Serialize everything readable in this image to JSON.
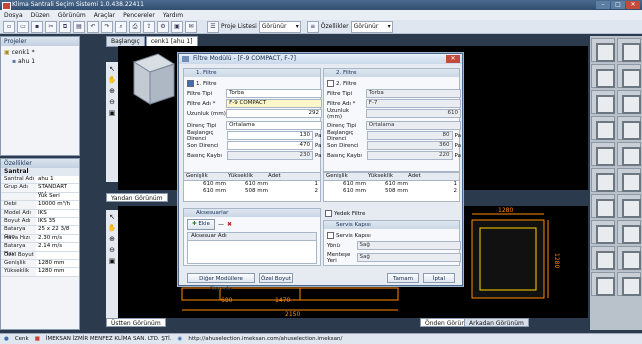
{
  "window": {
    "title": "Klima Santrali Seçim Sistemi 1.0.438.22411"
  },
  "menu": [
    "Dosya",
    "Düzen",
    "Görünüm",
    "Araçlar",
    "Pencereler",
    "Yardım"
  ],
  "toolbar": {
    "project_list_label": "Proje Listesi",
    "view_combo_1": "Görünür",
    "properties_label": "Özellikler",
    "view_combo_2": "Görünür"
  },
  "projects_panel": {
    "title": "Projeler",
    "tree": [
      {
        "label": "cenk1 *"
      },
      {
        "label": "ahu 1"
      }
    ]
  },
  "properties_panel": {
    "title": "Özellikler",
    "section": "Santral",
    "rows": [
      {
        "k": "Santral Adı",
        "v": "ahu 1"
      },
      {
        "k": "Grup Adı",
        "v": "STANDART KLİ..."
      },
      {
        "k": "",
        "v": "Yük Seri"
      },
      {
        "k": "Debi",
        "v": "10000 m³/h"
      },
      {
        "k": "Model Adı",
        "v": "IKS"
      },
      {
        "k": "Boyut Adı",
        "v": "IKS 35"
      },
      {
        "k": "Batarya Geo",
        "v": "25 x 22 3/8"
      },
      {
        "k": "Hava Hızı",
        "v": "2.30 m/s"
      },
      {
        "k": "Batarya Hav",
        "v": "2.14 m/s"
      },
      {
        "k": "Özel Boyut",
        "v": ""
      },
      {
        "k": "Genişlik",
        "v": "1280 mm"
      },
      {
        "k": "Yükseklik",
        "v": "1280 mm"
      }
    ]
  },
  "doc_tabs": [
    "Başlangıç",
    "cenk1 [ahu 1]"
  ],
  "view_labels": {
    "side": "Yandan Görünüm",
    "top": "Üstten Görünüm",
    "front": "Önden Görünüm",
    "back": "Arkadan Görünüm"
  },
  "drawing_dims": {
    "top": [
      "1470",
      "2150",
      "680"
    ],
    "front_w": "1280",
    "front_h": "1280"
  },
  "dialog": {
    "title": "Filtre Modülü - [F-9 COMPACT, F-7]",
    "filter1": {
      "header": "1. Filtre",
      "check_label": "1. Filtre",
      "type_label": "Filtre Tipi",
      "type_value": "Torba",
      "name_label": "Filtre Adı *",
      "name_value": "F-9 COMPACT",
      "length_label": "Uzunluk (mm)",
      "length_value": "292",
      "res_type_label": "Direnç Tipi",
      "res_type_value": "Ortalama",
      "start_res_label": "Başlangıç Direnci",
      "start_res_value": "130",
      "start_res_unit": "Pa",
      "end_res_label": "Son Direnci",
      "end_res_value": "470",
      "end_res_unit": "Pa",
      "pressure_label": "Basınç Kaybı",
      "pressure_value": "230",
      "pressure_unit": "Pa"
    },
    "filter2": {
      "header": "2. Filtre",
      "check_label": "2. Filtre",
      "type_label": "Filtre Tipi",
      "type_value": "Torba",
      "name_label": "Filtre Adı *",
      "name_value": "F-7",
      "length_label": "Uzunluk (mm)",
      "length_value": "610",
      "res_type_label": "Direnç Tipi",
      "res_type_value": "Ortalama",
      "start_res_label": "Başlangıç Direnci",
      "start_res_value": "80",
      "start_res_unit": "Pa",
      "end_res_label": "Son Direnci",
      "end_res_value": "360",
      "end_res_unit": "Pa",
      "pressure_label": "Basınç Kaybı",
      "pressure_value": "220",
      "pressure_unit": "Pa"
    },
    "grid_headers": [
      "Genişlik",
      "Yükseklik",
      "Adet"
    ],
    "grid1": [
      [
        "610 mm",
        "610 mm",
        "1"
      ],
      [
        "610 mm",
        "508 mm",
        "2"
      ]
    ],
    "grid2": [
      [
        "610 mm",
        "610 mm",
        "1"
      ],
      [
        "610 mm",
        "508 mm",
        "2"
      ]
    ],
    "accessories": {
      "header": "Aksesuarlar",
      "add_label": "Ekle",
      "col_label": "Aksesuar Adı"
    },
    "spare_filter_label": "Yedek Filtre",
    "service_door": {
      "header": "Servis Kapısı",
      "check_label": "Servis Kapısı",
      "side_label": "Yönü",
      "side_value": "Sağ",
      "hinge_label": "Menteşe Yeri",
      "hinge_value": "Sağ"
    },
    "buttons": {
      "copy_other": "Diğer Modüllere Kopyala",
      "custom_size": "Özel Boyut",
      "ok": "Tamam",
      "cancel": "İptal"
    }
  },
  "statusbar": {
    "user": "Cenk",
    "company": "İMEKSAN İZMİR MENFEZ KLİMA SAN. LTD. ŞTİ.",
    "url": "http://ahuselection.imeksan.com/ahuselection.imeksan/"
  }
}
